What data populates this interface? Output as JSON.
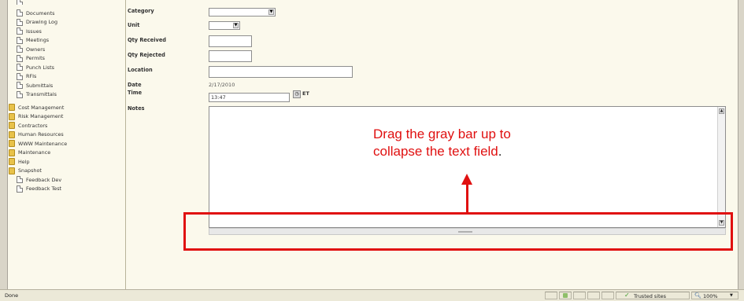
{
  "sidebar": {
    "sub_items": [
      {
        "label": "Documents",
        "icon": "document-icon"
      },
      {
        "label": "Drawing Log",
        "icon": "document-icon"
      },
      {
        "label": "Issues",
        "icon": "document-icon"
      },
      {
        "label": "Meetings",
        "icon": "document-icon"
      },
      {
        "label": "Owners",
        "icon": "document-icon"
      },
      {
        "label": "Permits",
        "icon": "document-icon"
      },
      {
        "label": "Punch Lists",
        "icon": "document-icon"
      },
      {
        "label": "RFIs",
        "icon": "document-icon"
      },
      {
        "label": "Submittals",
        "icon": "document-icon"
      },
      {
        "label": "Transmittals",
        "icon": "document-icon"
      }
    ],
    "top_items": [
      {
        "label": "Cost Management",
        "icon": "folder-icon"
      },
      {
        "label": "Risk Management",
        "icon": "folder-icon"
      },
      {
        "label": "Contractors",
        "icon": "folder-icon"
      },
      {
        "label": "Human Resources",
        "icon": "folder-icon"
      },
      {
        "label": "WWW Maintenance",
        "icon": "folder-icon"
      },
      {
        "label": "Maintenance",
        "icon": "folder-icon"
      },
      {
        "label": "Help",
        "icon": "folder-icon"
      },
      {
        "label": "Snapshot",
        "icon": "folder-icon"
      }
    ],
    "page_items": [
      {
        "label": "Feedback Dev",
        "icon": "document-icon"
      },
      {
        "label": "Feedback Test",
        "icon": "document-icon"
      }
    ]
  },
  "form": {
    "category_label": "Category",
    "category_value": "",
    "unit_label": "Unit",
    "unit_value": "",
    "qty_received_label": "Qty Received",
    "qty_received_value": "",
    "qty_rejected_label": "Qty Rejected",
    "qty_rejected_value": "",
    "location_label": "Location",
    "location_value": "",
    "date_label": "Date",
    "date_value": "2/17/2010",
    "time_label": "Time",
    "time_value": "13:47",
    "timezone": "ET",
    "notes_label": "Notes",
    "notes_value": ""
  },
  "annotation": {
    "line1": "Drag the gray bar up to",
    "line2": "collapse the text field",
    "period": ".",
    "color": "#e01010"
  },
  "statusbar": {
    "status": "Done",
    "zone": "Trusted sites",
    "zoom": "100%"
  }
}
